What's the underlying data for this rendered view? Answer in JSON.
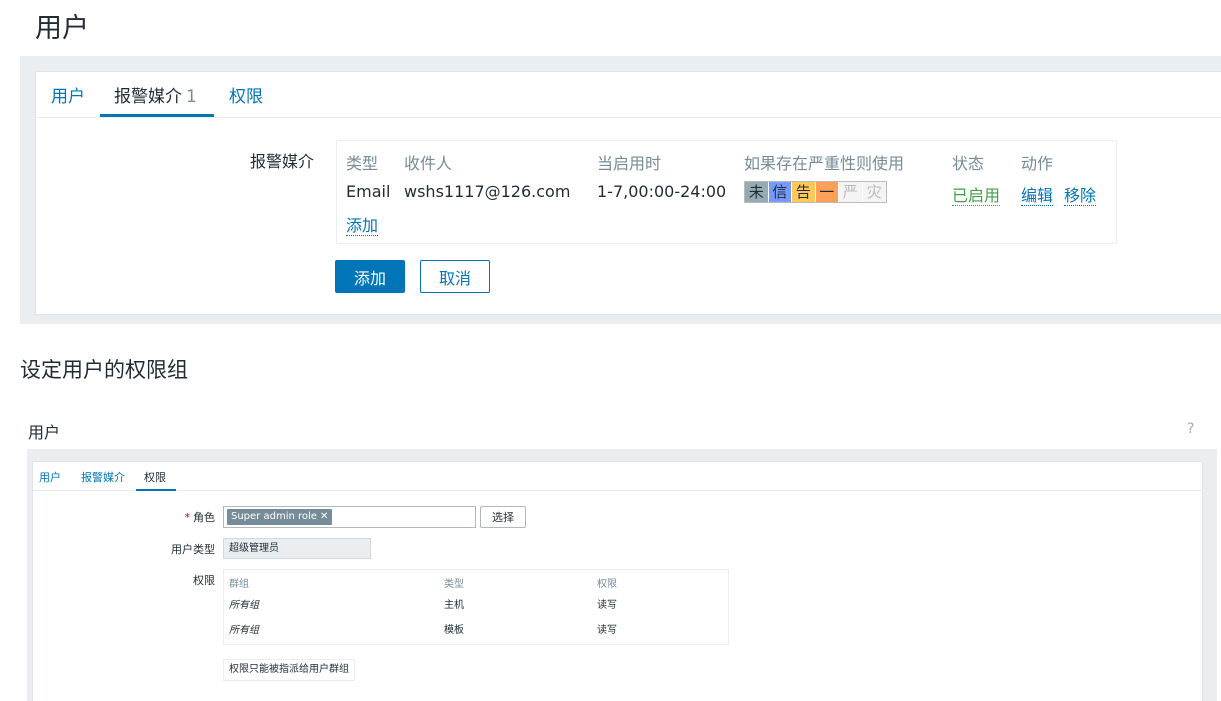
{
  "section1": {
    "title": "用户",
    "tabs": [
      {
        "label": "用户",
        "count": ""
      },
      {
        "label": "报警媒介",
        "count": "1"
      },
      {
        "label": "权限",
        "count": ""
      }
    ],
    "media_label": "报警媒介",
    "media_table": {
      "headers": [
        "类型",
        "收件人",
        "当启用时",
        "如果存在严重性则使用",
        "状态",
        "动作"
      ],
      "row": {
        "type": "Email",
        "recipient": "wshs1117@126.com",
        "when_active": "1-7,00:00-24:00",
        "severities": [
          {
            "label": "未",
            "color": "#97aab3",
            "text_color": "#1f2c33"
          },
          {
            "label": "信",
            "color": "#7499ff",
            "text_color": "#1f2c33"
          },
          {
            "label": "告",
            "color": "#ffc859",
            "text_color": "#1f2c33"
          },
          {
            "label": "一",
            "color": "#ffa059",
            "text_color": "#1f2c33"
          },
          {
            "label": "严",
            "color": "#f4f4f4",
            "text_color": "#bbbbbb"
          },
          {
            "label": "灾",
            "color": "#f4f4f4",
            "text_color": "#bbbbbb"
          }
        ],
        "status": "已启用",
        "edit": "编辑",
        "remove": "移除"
      },
      "add_link": "添加"
    },
    "buttons": {
      "add": "添加",
      "cancel": "取消"
    }
  },
  "section2": {
    "heading": "设定用户的权限组",
    "title": "用户",
    "help": "?",
    "tabs": [
      {
        "label": "用户"
      },
      {
        "label": "报警媒介"
      },
      {
        "label": "权限"
      }
    ],
    "role_label": "角色",
    "role_required_mark": "*",
    "role_chip": "Super admin role",
    "role_chip_remove": "✕",
    "select_button": "选择",
    "user_type_label": "用户类型",
    "user_type_value": "超级管理员",
    "permissions_label": "权限",
    "permissions_table": {
      "headers": [
        "群组",
        "类型",
        "权限"
      ],
      "rows": [
        [
          "所有组",
          "主机",
          "读写"
        ],
        [
          "所有组",
          "模板",
          "读写"
        ]
      ]
    },
    "note": "权限只能被指派给用户群组"
  }
}
